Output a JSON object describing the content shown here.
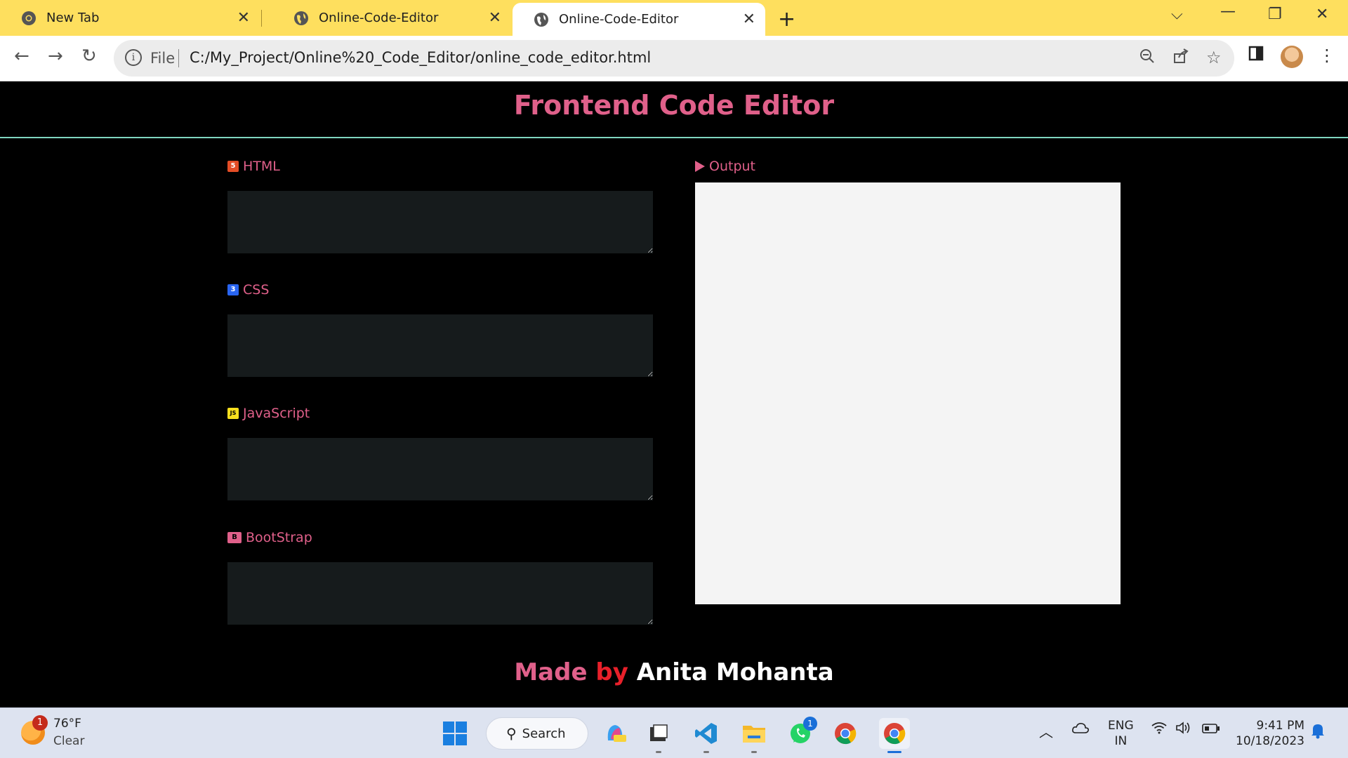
{
  "browser": {
    "tabs": [
      {
        "title": "New Tab",
        "icon": "chrome-icon",
        "active": false
      },
      {
        "title": "Online-Code-Editor",
        "icon": "globe-icon",
        "active": false
      },
      {
        "title": "Online-Code-Editor",
        "icon": "globe-icon",
        "active": true
      }
    ],
    "new_tab_glyph": "+",
    "address": {
      "scheme_label": "File",
      "url": "C:/My_Project/Online%20_Code_Editor/online_code_editor.html"
    },
    "accent_color": "#fedf5e"
  },
  "page": {
    "title": "Frontend Code Editor",
    "editors": [
      {
        "label": "HTML",
        "icon": "html5-icon",
        "icon_color": "#e44d26",
        "icon_glyph": "5"
      },
      {
        "label": "CSS",
        "icon": "css3-icon",
        "icon_color": "#2965f1",
        "icon_glyph": "3"
      },
      {
        "label": "JavaScript",
        "icon": "js-icon",
        "icon_color": "#f7df1e",
        "icon_glyph": "JS"
      },
      {
        "label": "BootStrap",
        "icon": "bootstrap-icon",
        "icon_color": "#e0608a",
        "icon_glyph": "B"
      }
    ],
    "output_label": "Output",
    "footer": {
      "made": "Made",
      "by": "by",
      "author": "Anita Mohanta"
    },
    "colors": {
      "accent": "#e0608a",
      "divider": "#7fd5c0",
      "editor_bg": "#161b1c",
      "output_bg": "#f4f4f4"
    }
  },
  "taskbar": {
    "weather": {
      "badge": "1",
      "temp": "76°F",
      "condition": "Clear"
    },
    "search_label": "Search",
    "whatsapp_badge": "1",
    "language": {
      "line1": "ENG",
      "line2": "IN"
    },
    "clock": {
      "time": "9:41 PM",
      "date": "10/18/2023"
    }
  }
}
